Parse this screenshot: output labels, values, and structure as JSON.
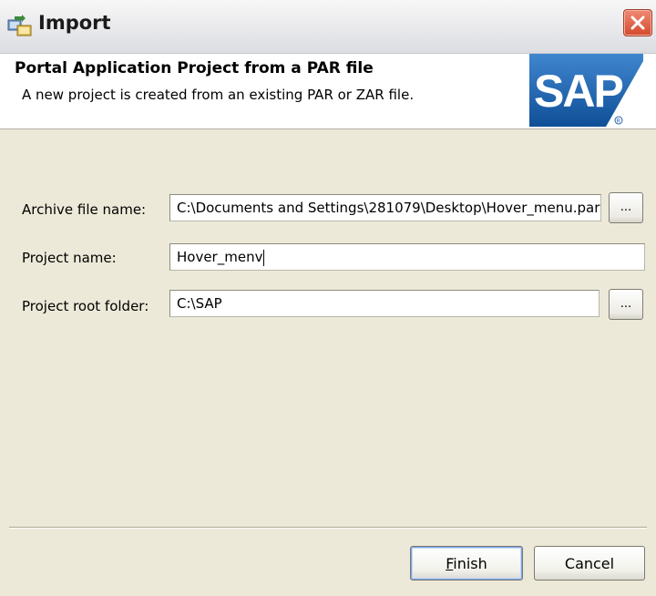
{
  "window": {
    "title": "Import",
    "icon": "import-wizard-icon",
    "close_icon": "close-icon"
  },
  "header": {
    "title": "Portal Application Project from a PAR file",
    "description": "A new project is created from an existing PAR or ZAR file.",
    "logo_text": "SAP",
    "logo_color": "#1f5fa8"
  },
  "form": {
    "archive_label": "Archive file name:",
    "archive_value": "C:\\Documents and Settings\\281079\\Desktop\\Hover_menu.par",
    "project_label": "Project name:",
    "project_value": "Hover_menv",
    "root_label": "Project root folder:",
    "root_value": "C:\\SAP",
    "browse_label": "..."
  },
  "buttons": {
    "finish_mnemonic": "F",
    "finish_rest": "inish",
    "cancel": "Cancel"
  }
}
